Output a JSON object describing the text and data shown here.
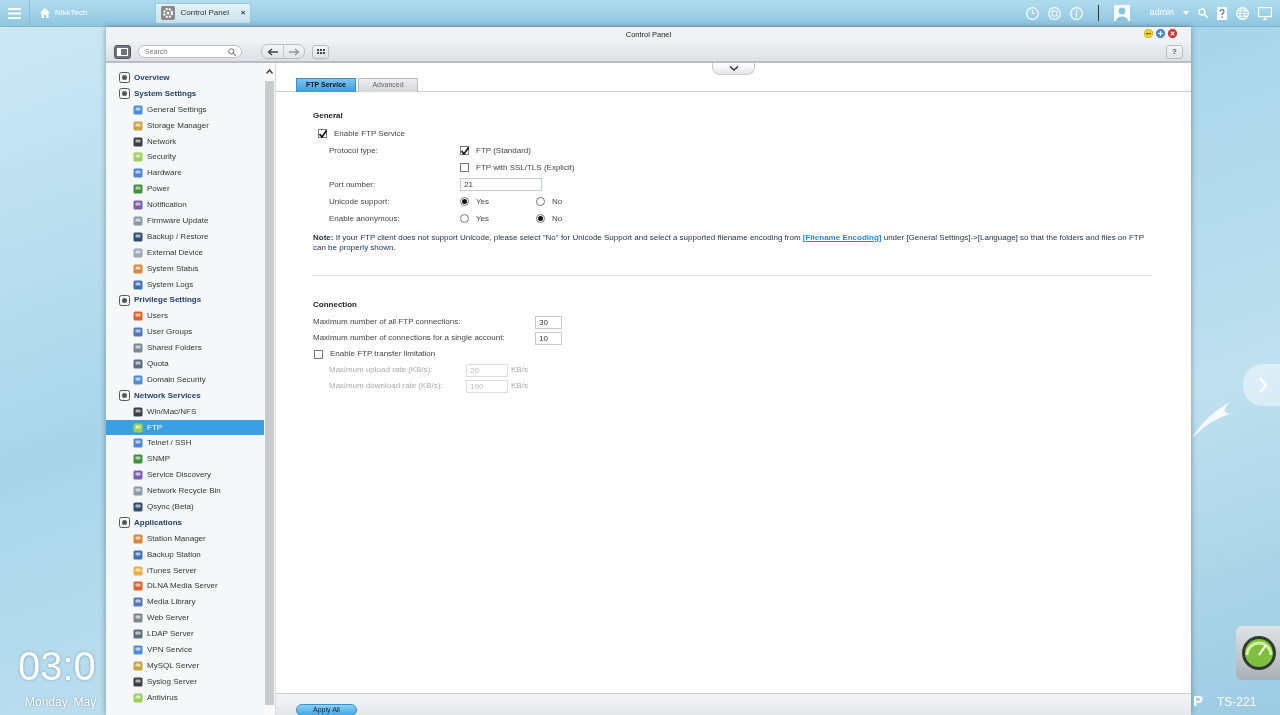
{
  "taskbar": {
    "home_label": "NikkTech",
    "tabs": [
      {
        "label": "Control Panel",
        "close": "×",
        "selected": true
      }
    ],
    "user": "admin"
  },
  "desktop": {
    "clock": "03:0",
    "date": "Monday, May",
    "model": "TS-221",
    "logo": "P"
  },
  "window": {
    "title": "Control Panel",
    "search": {
      "placeholder": "Search"
    },
    "help": "?"
  },
  "sidebar": {
    "items": [
      {
        "label": "Overview",
        "selected": false
      },
      {
        "label": "System Settings",
        "selected": false,
        "children": [
          {
            "label": "General Settings",
            "selected": false
          },
          {
            "label": "Storage Manager",
            "selected": false
          },
          {
            "label": "Network",
            "selected": false
          },
          {
            "label": "Security",
            "selected": false
          },
          {
            "label": "Hardware",
            "selected": false
          },
          {
            "label": "Power",
            "selected": false
          },
          {
            "label": "Notification",
            "selected": false
          },
          {
            "label": "Firmware Update",
            "selected": false
          },
          {
            "label": "Backup / Restore",
            "selected": false
          },
          {
            "label": "External Device",
            "selected": false
          },
          {
            "label": "System Status",
            "selected": false
          },
          {
            "label": "System Logs",
            "selected": false
          }
        ]
      },
      {
        "label": "Privilege Settings",
        "selected": false,
        "children": [
          {
            "label": "Users",
            "selected": false
          },
          {
            "label": "User Groups",
            "selected": false
          },
          {
            "label": "Shared Folders",
            "selected": false
          },
          {
            "label": "Quota",
            "selected": false
          },
          {
            "label": "Domain Security",
            "selected": false
          }
        ]
      },
      {
        "label": "Network Services",
        "selected": false,
        "children": [
          {
            "label": "Win/Mac/NFS",
            "selected": false
          },
          {
            "label": "FTP",
            "selected": true
          },
          {
            "label": "Telnet / SSH",
            "selected": false
          },
          {
            "label": "SNMP",
            "selected": false
          },
          {
            "label": "Service Discovery",
            "selected": false
          },
          {
            "label": "Network Recycle Bin",
            "selected": false
          },
          {
            "label": "Qsync (Beta)",
            "selected": false
          }
        ]
      },
      {
        "label": "Applications",
        "selected": false,
        "children": [
          {
            "label": "Station Manager",
            "selected": false
          },
          {
            "label": "Backup Station",
            "selected": false
          },
          {
            "label": "iTunes Server",
            "selected": false
          },
          {
            "label": "DLNA Media Server",
            "selected": false
          },
          {
            "label": "Media Library",
            "selected": false
          },
          {
            "label": "Web Server",
            "selected": false
          },
          {
            "label": "LDAP Server",
            "selected": false
          },
          {
            "label": "VPN Service",
            "selected": false
          },
          {
            "label": "MySQL Server",
            "selected": false
          },
          {
            "label": "Syslog Server",
            "selected": false
          },
          {
            "label": "Antivirus",
            "selected": false
          }
        ]
      }
    ]
  },
  "tabs": [
    {
      "label": "FTP Service",
      "selected": true
    },
    {
      "label": "Advanced",
      "selected": false
    }
  ],
  "general": {
    "heading": "General",
    "enable": {
      "label": "Enable FTP Service",
      "checked": true
    },
    "protocol": {
      "label": "Protocol type:",
      "options": [
        {
          "label": "FTP (Standard)",
          "checked": true
        },
        {
          "label": "FTP with SSL/TLS (Explicit)",
          "checked": false
        }
      ]
    },
    "port": {
      "label": "Port number:",
      "value": "21"
    },
    "unicode": {
      "label": "Unicode support:",
      "options": [
        {
          "label": "Yes",
          "selected": true
        },
        {
          "label": "No",
          "selected": false
        }
      ]
    },
    "anonymous": {
      "label": "Enable anonymous:",
      "options": [
        {
          "label": "Yes",
          "selected": false
        },
        {
          "label": "No",
          "selected": true
        }
      ]
    },
    "note": {
      "before": "**Note:** If your FTP client does not support Unicode, please select \"No\" for Unicode Support and select a supported filename encoding from ",
      "link": "[Filename Encoding]",
      "after": " under [General Settings]->[Language] so that the folders and files on FTP can be properly shown."
    }
  },
  "connection": {
    "heading": "Connection",
    "fields": [
      {
        "label": "Maximum number of all FTP connections:",
        "value": "30"
      },
      {
        "label": "Maximum number of connections for a single account:",
        "value": "10"
      }
    ],
    "limitation": {
      "label": "Enable FTP transfer limitation",
      "checked": false
    },
    "rates": [
      {
        "label": "Maximum upload rate (KB/s):",
        "value": "20",
        "unit": "KB/s",
        "disabled": true
      },
      {
        "label": "Maximum download rate (KB/s):",
        "value": "100",
        "unit": "KB/s",
        "disabled": true
      }
    ]
  },
  "footer": {
    "apply": "Apply All"
  }
}
